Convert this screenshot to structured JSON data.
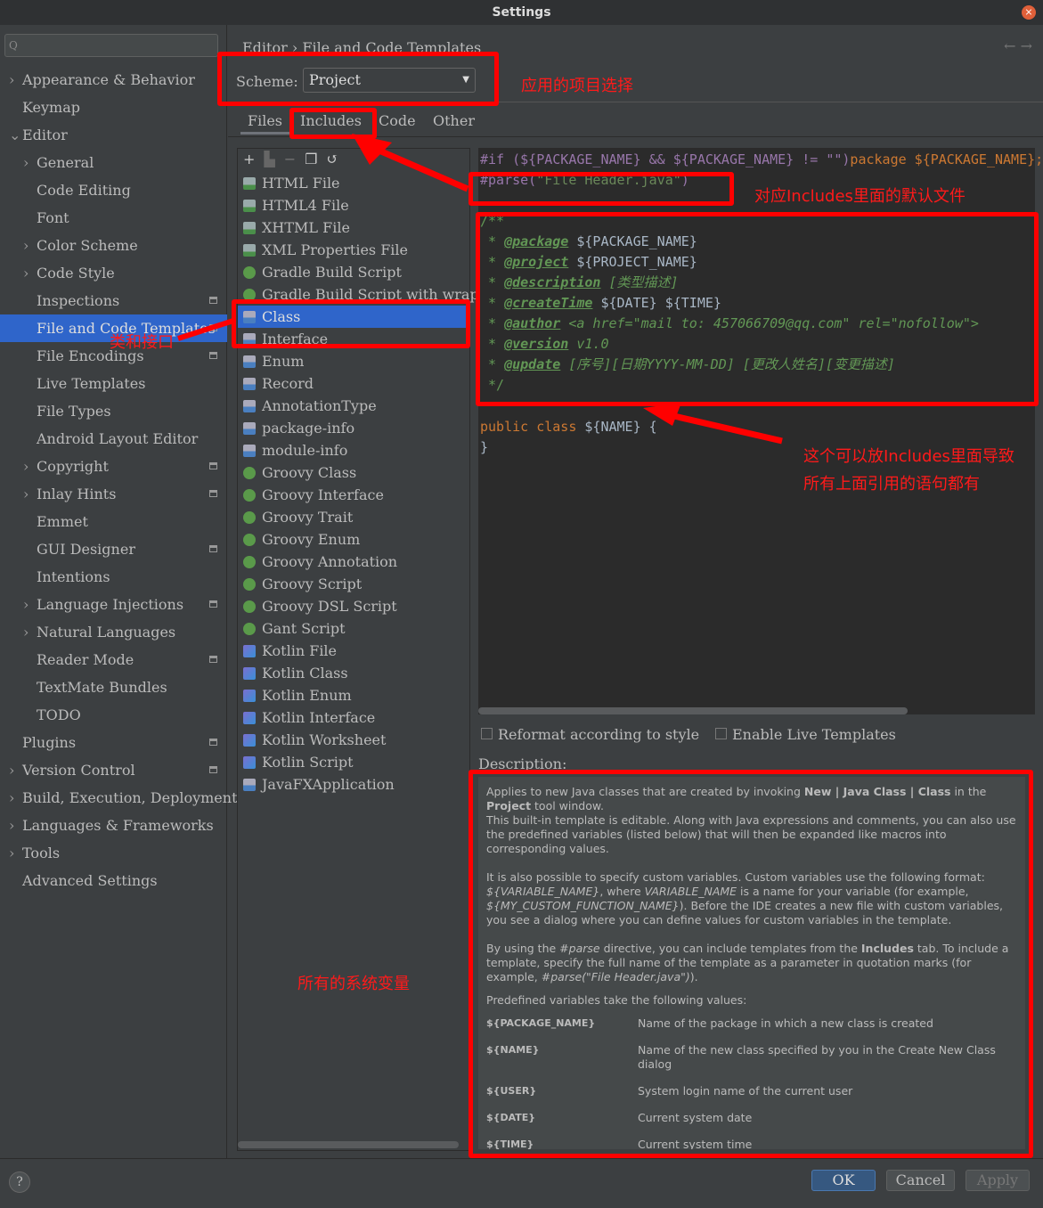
{
  "window": {
    "title": "Settings",
    "close_icon": "close-icon"
  },
  "search": {
    "placeholder": "Q"
  },
  "sidebar": {
    "items": [
      {
        "label": "Appearance & Behavior",
        "level": 0,
        "chevron": "right"
      },
      {
        "label": "Keymap",
        "level": 0
      },
      {
        "label": "Editor",
        "level": 0,
        "chevron": "down"
      },
      {
        "label": "General",
        "level": 1,
        "chevron": "right"
      },
      {
        "label": "Code Editing",
        "level": 1
      },
      {
        "label": "Font",
        "level": 1
      },
      {
        "label": "Color Scheme",
        "level": 1,
        "chevron": "right"
      },
      {
        "label": "Code Style",
        "level": 1,
        "chevron": "right"
      },
      {
        "label": "Inspections",
        "level": 1,
        "gear": true
      },
      {
        "label": "File and Code Templates",
        "level": 1,
        "gear": true,
        "selected": true
      },
      {
        "label": "File Encodings",
        "level": 1,
        "gear": true
      },
      {
        "label": "Live Templates",
        "level": 1
      },
      {
        "label": "File Types",
        "level": 1
      },
      {
        "label": "Android Layout Editor",
        "level": 1
      },
      {
        "label": "Copyright",
        "level": 1,
        "chevron": "right",
        "gear": true
      },
      {
        "label": "Inlay Hints",
        "level": 1,
        "chevron": "right",
        "gear": true
      },
      {
        "label": "Emmet",
        "level": 1
      },
      {
        "label": "GUI Designer",
        "level": 1,
        "gear": true
      },
      {
        "label": "Intentions",
        "level": 1
      },
      {
        "label": "Language Injections",
        "level": 1,
        "chevron": "right",
        "gear": true
      },
      {
        "label": "Natural Languages",
        "level": 1,
        "chevron": "right"
      },
      {
        "label": "Reader Mode",
        "level": 1,
        "gear": true
      },
      {
        "label": "TextMate Bundles",
        "level": 1
      },
      {
        "label": "TODO",
        "level": 1
      },
      {
        "label": "Plugins",
        "level": 0,
        "gear": true
      },
      {
        "label": "Version Control",
        "level": 0,
        "chevron": "right",
        "gear": true
      },
      {
        "label": "Build, Execution, Deployment",
        "level": 0,
        "chevron": "right"
      },
      {
        "label": "Languages & Frameworks",
        "level": 0,
        "chevron": "right"
      },
      {
        "label": "Tools",
        "level": 0,
        "chevron": "right"
      },
      {
        "label": "Advanced Settings",
        "level": 0
      }
    ]
  },
  "breadcrumb": {
    "parent": "Editor",
    "sep": "›",
    "current": "File and Code Templates"
  },
  "scheme": {
    "label": "Scheme:",
    "value": "Project"
  },
  "tabs": [
    "Files",
    "Includes",
    "Code",
    "Other"
  ],
  "templates": [
    {
      "label": "HTML File",
      "icon": "fi"
    },
    {
      "label": "HTML4 File",
      "icon": "fi"
    },
    {
      "label": "XHTML File",
      "icon": "fi"
    },
    {
      "label": "XML Properties File",
      "icon": "fi"
    },
    {
      "label": "Gradle Build Script",
      "icon": "gr"
    },
    {
      "label": "Gradle Build Script with wrapper",
      "icon": "gr"
    },
    {
      "label": "Class",
      "icon": "jv",
      "selected": true
    },
    {
      "label": "Interface",
      "icon": "jv"
    },
    {
      "label": "Enum",
      "icon": "jv"
    },
    {
      "label": "Record",
      "icon": "jv"
    },
    {
      "label": "AnnotationType",
      "icon": "jv"
    },
    {
      "label": "package-info",
      "icon": "jv"
    },
    {
      "label": "module-info",
      "icon": "jv"
    },
    {
      "label": "Groovy Class",
      "icon": "gr"
    },
    {
      "label": "Groovy Interface",
      "icon": "gr"
    },
    {
      "label": "Groovy Trait",
      "icon": "gr"
    },
    {
      "label": "Groovy Enum",
      "icon": "gr"
    },
    {
      "label": "Groovy Annotation",
      "icon": "gr"
    },
    {
      "label": "Groovy Script",
      "icon": "gr"
    },
    {
      "label": "Groovy DSL Script",
      "icon": "gr"
    },
    {
      "label": "Gant Script",
      "icon": "gr"
    },
    {
      "label": "Kotlin File",
      "icon": "kt"
    },
    {
      "label": "Kotlin Class",
      "icon": "kt"
    },
    {
      "label": "Kotlin Enum",
      "icon": "kt"
    },
    {
      "label": "Kotlin Interface",
      "icon": "kt"
    },
    {
      "label": "Kotlin Worksheet",
      "icon": "kt"
    },
    {
      "label": "Kotlin Script",
      "icon": "kt"
    },
    {
      "label": "JavaFXApplication",
      "icon": "jv"
    }
  ],
  "toolbar": [
    "add-icon",
    "add-child-icon",
    "remove-icon",
    "copy-icon",
    "reset-icon"
  ],
  "code": {
    "l1a": "#if (${PACKAGE_NAME} && ${PACKAGE_NAME} != \"\")",
    "l1b": "package ${PACKAGE_NAME};",
    "l2a": "#parse(",
    "l2b": "\"File Header.java\"",
    "l2c": ")",
    "c0": "/**",
    "tags": [
      {
        "tag": "@package",
        "val": "${PACKAGE_NAME}",
        "cls": "var"
      },
      {
        "tag": "@project",
        "val": "${PROJECT_NAME}",
        "cls": "var"
      },
      {
        "tag": "@description",
        "val": "[类型描述]",
        "cls": "cm"
      },
      {
        "tag": "@createTime",
        "val": "${DATE} ${TIME}",
        "cls": "var"
      },
      {
        "tag": "@author",
        "val": "<a href=\"mail to: 457066709@qq.com\" rel=\"nofollow\">",
        "cls": "cm"
      },
      {
        "tag": "@version",
        "val": "v1.0",
        "cls": "cm"
      },
      {
        "tag": "@update",
        "val": "[序号][日期YYYY-MM-DD] [更改人姓名][变更描述]",
        "cls": "cm"
      }
    ],
    "cend": " */",
    "p1": "public class",
    "p2": " ${NAME} {",
    "p3": "}"
  },
  "options": {
    "reformat": "Reformat according to style",
    "live": "Enable Live Templates"
  },
  "description": {
    "label": "Description:",
    "p1a": "Applies to new Java classes that are created by invoking ",
    "p1b": "New | Java Class | Class",
    "p1c": " in the ",
    "p1d": "Project",
    "p1e": " tool window.",
    "p1f": "This built-in template is editable. Along with Java expressions and comments, you can also use the predefined variables (listed below) that will then be expanded like macros into corresponding values.",
    "p2a": "It is also possible to specify custom variables. Custom variables use the following format: ",
    "p2b": "${VARIABLE_NAME}",
    "p2c": ", where ",
    "p2d": "VARIABLE_NAME",
    "p2e": " is a name for your variable (for example, ",
    "p2f": "${MY_CUSTOM_FUNCTION_NAME}",
    "p2g": "). Before the IDE creates a new file with custom variables, you see a dialog where you can define values for custom variables in the template.",
    "p3a": "By using the ",
    "p3b": "#parse",
    "p3c": " directive, you can include templates from the ",
    "p3d": "Includes",
    "p3e": " tab. To include a template, specify the full name of the template as a parameter in quotation marks (for example, ",
    "p3f": "#parse(\"File Header.java\")",
    "p3g": ").",
    "p4": "Predefined variables take the following values:",
    "vars": [
      {
        "name": "${PACKAGE_NAME}",
        "desc": "Name of the package in which a new class is created"
      },
      {
        "name": "${NAME}",
        "desc": "Name of the new class specified by you in the Create New Class dialog"
      },
      {
        "name": "${USER}",
        "desc": "System login name of the current user"
      },
      {
        "name": "${DATE}",
        "desc": "Current system date"
      },
      {
        "name": "${TIME}",
        "desc": "Current system time"
      }
    ]
  },
  "buttons": {
    "help": "?",
    "ok": "OK",
    "cancel": "Cancel",
    "apply": "Apply"
  },
  "annotations": {
    "scheme": "应用的项目选择",
    "includes": "对应Includes里面的默认文件",
    "class": "类和接口",
    "body1": "这个可以放Includes里面导致",
    "body2": "所有上面引用的语句都有",
    "vars": "所有的系统变量"
  },
  "colors": {
    "accent": "#2f65ca",
    "annotation": "#ff0000",
    "background": "#3c3f41",
    "editor": "#2b2b2b"
  }
}
